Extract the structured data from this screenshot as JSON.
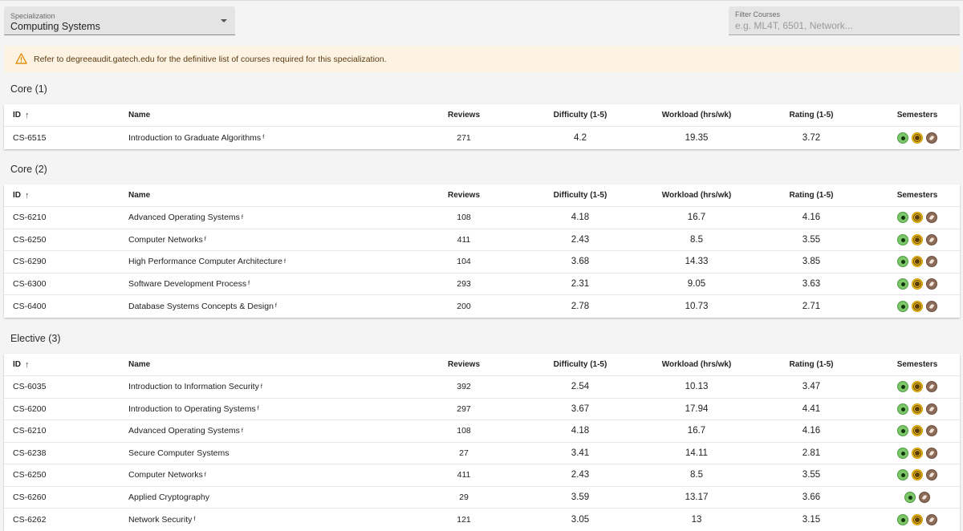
{
  "specialization": {
    "label": "Specialization",
    "value": "Computing Systems"
  },
  "filter": {
    "label": "Filter Courses",
    "placeholder": "e.g. ML4T, 6501, Network..."
  },
  "notice": {
    "text": "Refer to degreeaudit.gatech.edu for the definitive list of courses required for this specialization."
  },
  "columns": {
    "id": "ID",
    "name": "Name",
    "reviews": "Reviews",
    "difficulty": "Difficulty (1-5)",
    "workload": "Workload (hrs/wk)",
    "rating": "Rating (1-5)",
    "semesters": "Semesters"
  },
  "sections": [
    {
      "title": "Core (1)",
      "rows": [
        {
          "id": "CS-6515",
          "name": "Introduction to Graduate Algorithms",
          "foundational": true,
          "reviews": "271",
          "difficulty": "4.2",
          "workload": "19.35",
          "rating": "3.72",
          "semesters": [
            "spring",
            "summer",
            "fall"
          ]
        }
      ]
    },
    {
      "title": "Core (2)",
      "rows": [
        {
          "id": "CS-6210",
          "name": "Advanced Operating Systems",
          "foundational": true,
          "reviews": "108",
          "difficulty": "4.18",
          "workload": "16.7",
          "rating": "4.16",
          "semesters": [
            "spring",
            "summer",
            "fall"
          ]
        },
        {
          "id": "CS-6250",
          "name": "Computer Networks",
          "foundational": true,
          "reviews": "411",
          "difficulty": "2.43",
          "workload": "8.5",
          "rating": "3.55",
          "semesters": [
            "spring",
            "summer",
            "fall"
          ]
        },
        {
          "id": "CS-6290",
          "name": "High Performance Computer Architecture",
          "foundational": true,
          "reviews": "104",
          "difficulty": "3.68",
          "workload": "14.33",
          "rating": "3.85",
          "semesters": [
            "spring",
            "summer",
            "fall"
          ]
        },
        {
          "id": "CS-6300",
          "name": "Software Development Process",
          "foundational": true,
          "reviews": "293",
          "difficulty": "2.31",
          "workload": "9.05",
          "rating": "3.63",
          "semesters": [
            "spring",
            "summer",
            "fall"
          ]
        },
        {
          "id": "CS-6400",
          "name": "Database Systems Concepts & Design",
          "foundational": true,
          "reviews": "200",
          "difficulty": "2.78",
          "workload": "10.73",
          "rating": "2.71",
          "semesters": [
            "spring",
            "summer",
            "fall"
          ]
        }
      ]
    },
    {
      "title": "Elective (3)",
      "rows": [
        {
          "id": "CS-6035",
          "name": "Introduction to Information Security",
          "foundational": true,
          "reviews": "392",
          "difficulty": "2.54",
          "workload": "10.13",
          "rating": "3.47",
          "semesters": [
            "spring",
            "summer",
            "fall"
          ]
        },
        {
          "id": "CS-6200",
          "name": "Introduction to Operating Systems",
          "foundational": true,
          "reviews": "297",
          "difficulty": "3.67",
          "workload": "17.94",
          "rating": "4.41",
          "semesters": [
            "spring",
            "summer",
            "fall"
          ]
        },
        {
          "id": "CS-6210",
          "name": "Advanced Operating Systems",
          "foundational": true,
          "reviews": "108",
          "difficulty": "4.18",
          "workload": "16.7",
          "rating": "4.16",
          "semesters": [
            "spring",
            "summer",
            "fall"
          ]
        },
        {
          "id": "CS-6238",
          "name": "Secure Computer Systems",
          "foundational": false,
          "reviews": "27",
          "difficulty": "3.41",
          "workload": "14.11",
          "rating": "2.81",
          "semesters": [
            "spring",
            "summer",
            "fall"
          ]
        },
        {
          "id": "CS-6250",
          "name": "Computer Networks",
          "foundational": true,
          "reviews": "411",
          "difficulty": "2.43",
          "workload": "8.5",
          "rating": "3.55",
          "semesters": [
            "spring",
            "summer",
            "fall"
          ]
        },
        {
          "id": "CS-6260",
          "name": "Applied Cryptography",
          "foundational": false,
          "reviews": "29",
          "difficulty": "3.59",
          "workload": "13.17",
          "rating": "3.66",
          "semesters": [
            "spring",
            "fall"
          ]
        },
        {
          "id": "CS-6262",
          "name": "Network Security",
          "foundational": true,
          "reviews": "121",
          "difficulty": "3.05",
          "workload": "13",
          "rating": "3.15",
          "semesters": [
            "spring",
            "summer",
            "fall"
          ]
        }
      ]
    }
  ],
  "foundational_marker": "f",
  "sort_indicator": "↑"
}
